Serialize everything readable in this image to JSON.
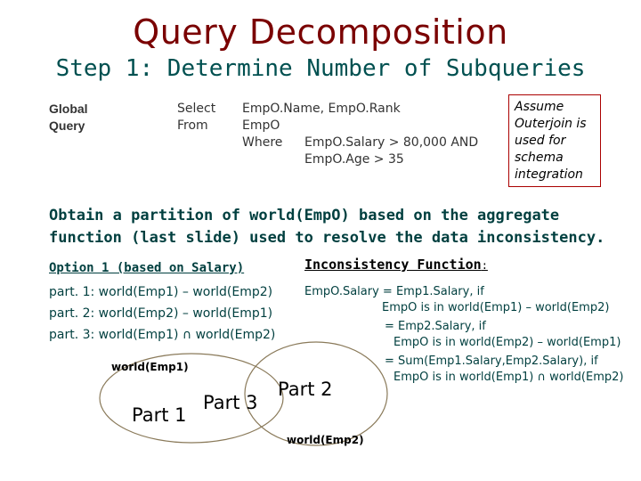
{
  "title": "Query Decomposition",
  "subtitle": "Step 1: Determine Number of Subqueries",
  "global_query": {
    "label_line1": "Global",
    "label_line2": "Query",
    "select_kw": "Select",
    "from_kw": "From",
    "where_kw": "Where",
    "select_val": "EmpO.Name, EmpO.Rank",
    "from_val": "EmpO",
    "where_cond1": "EmpO.Salary > 80,000   AND",
    "where_cond2": "EmpO.Age > 35"
  },
  "assume_box": {
    "text": "Assume Outerjoin is used for schema integration"
  },
  "obtain": {
    "line1": "Obtain a partition of world(EmpO) based on the aggregate",
    "line2": "function (last slide) used to resolve the data inconsistency."
  },
  "option": {
    "heading": "Option 1 (based on Salary)",
    "parts": [
      "part. 1: world(Emp1) – world(Emp2)",
      "part. 2: world(Emp2) – world(Emp1)",
      "part. 3: world(Emp1) ∩ world(Emp2)"
    ]
  },
  "inconsistency": {
    "heading": "Inconsistency Function",
    "colon": ":",
    "lines": [
      "EmpO.Salary = Emp1.Salary, if",
      "EmpO is in world(Emp1) – world(Emp2)",
      "= Emp2.Salary, if",
      "EmpO is in world(Emp2) – world(Emp1)",
      "= Sum(Emp1.Salary,Emp2.Salary), if",
      "EmpO is in world(Emp1) ∩ world(Emp2)"
    ]
  },
  "venn": {
    "set1_label": "world(Emp1)",
    "set2_label": "world(Emp2)",
    "part1": "Part 1",
    "part2": "Part 2",
    "part3": "Part 3"
  },
  "colors": {
    "title": "#7a0000",
    "subtitle": "#005050",
    "body_text": "#003f3f",
    "box_border": "#aa0000",
    "venn_stroke": "#8a7a5a"
  }
}
